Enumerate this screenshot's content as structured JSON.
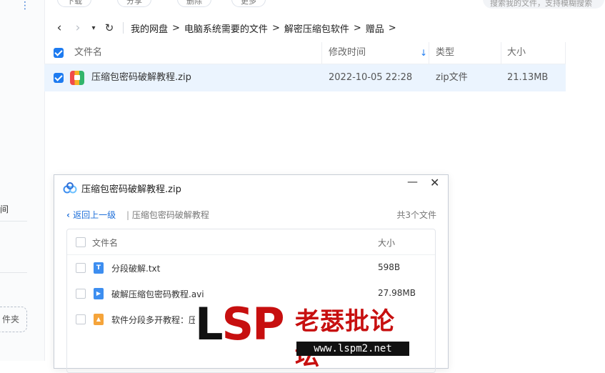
{
  "sidebar": {
    "more_icon": "⋮",
    "partial_text": "间",
    "new_folder_partial": "件夹"
  },
  "toolbar": {
    "btn1": "下载",
    "btn2": "分享",
    "btn3": "删除",
    "btn4": "更多",
    "search_placeholder": "搜索我的文件，支持模糊搜索"
  },
  "nav": {
    "back_icon": "‹",
    "forward_icon": "›",
    "dropdown_icon": "▾",
    "refresh_icon": "↻",
    "breadcrumb": [
      "我的网盘",
      "电脑系统需要的文件",
      "解密压缩包软件",
      "赠品"
    ],
    "separator": ">"
  },
  "table": {
    "columns": [
      "文件名",
      "修改时间",
      "类型",
      "大小"
    ],
    "sort_icon": "↓",
    "rows": [
      {
        "name": "压缩包密码破解教程.zip",
        "modified": "2022-10-05 22:28",
        "type": "zip文件",
        "size": "21.13MB",
        "selected": true
      }
    ]
  },
  "dialog": {
    "title": "压缩包密码破解教程.zip",
    "minimize_icon": "—",
    "close_icon": "✕",
    "back_link": "返回上一级",
    "path_sep": "|",
    "path": "压缩包密码破解教程",
    "count": "共3个文件",
    "col_name": "文件名",
    "col_size": "大小",
    "files": [
      {
        "name": "分段破解.txt",
        "size": "598B",
        "icon": "T",
        "color": "#3d8ef0"
      },
      {
        "name": "破解压缩包密码教程.avi",
        "size": "27.98MB",
        "icon": "▶",
        "color": "#3d8ef0"
      },
      {
        "name": "软件分段多开教程：压",
        "size": "",
        "icon": "▲",
        "color": "#f5a43a"
      }
    ]
  },
  "watermark": {
    "logo_l": "L",
    "logo_sp": "SP",
    "site_name": "老瑟批论坛",
    "url": "www.lspm2.net"
  }
}
